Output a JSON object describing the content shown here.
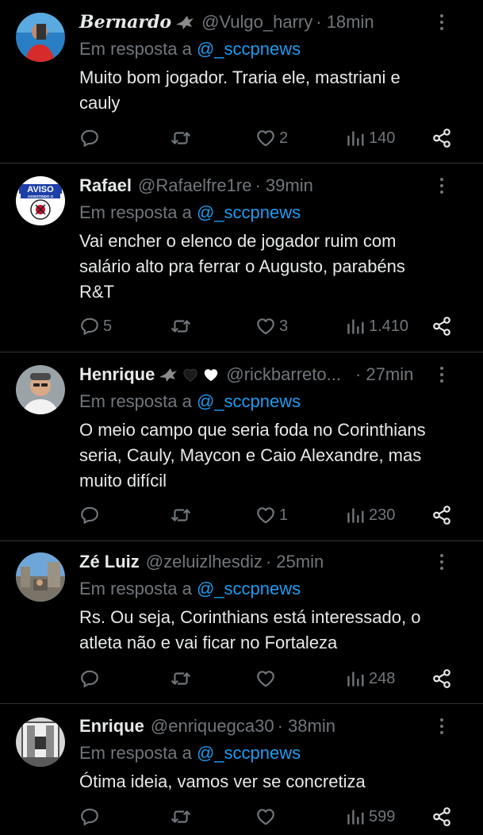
{
  "tweets": [
    {
      "name": "Bernardo",
      "handle": "@Vulgo_harry",
      "time": "· 18min",
      "reply_prefix": "Em resposta a ",
      "reply_to": "@_sccpnews",
      "text_lines": [
        "Muito bom jogador. Traria ele, mastriani e",
        "cauly"
      ],
      "replies": "",
      "retweets": "",
      "likes": "2",
      "views": "140"
    },
    {
      "name": "Rafael",
      "handle": "@Rafaelfre1re",
      "time": "· 39min",
      "reply_prefix": "Em resposta a ",
      "reply_to": "@_sccpnews",
      "text_lines": [
        "Vai encher o elenco de jogador ruim com",
        "salário alto pra ferrar o Augusto, parabéns",
        "R&T"
      ],
      "replies": "5",
      "retweets": "",
      "likes": "3",
      "views": "1.410",
      "avatar_text": "AVISO",
      "avatar_subtext": "ASSISTINDO O"
    },
    {
      "name": "Henrique",
      "handle": "@rickbarreto...",
      "time": "· 27min",
      "reply_prefix": "Em resposta a ",
      "reply_to": "@_sccpnews",
      "text_lines": [
        "O meio campo que seria foda no Corinthians",
        "seria, Cauly, Maycon e Caio Alexandre, mas",
        "muito difícil"
      ],
      "replies": "",
      "retweets": "",
      "likes": "1",
      "views": "230"
    },
    {
      "name": "Zé Luiz",
      "handle": "@zeluizlhesdiz",
      "time": "· 25min",
      "reply_prefix": "Em resposta a ",
      "reply_to": "@_sccpnews",
      "text_lines": [
        "Rs. Ou seja, Corinthians está interessado, o",
        "atleta não e vai ficar no Fortaleza"
      ],
      "replies": "",
      "retweets": "",
      "likes": "",
      "views": "248"
    },
    {
      "name": "Enrique",
      "handle": "@enriquegca30",
      "time": "· 38min",
      "reply_prefix": "Em resposta a ",
      "reply_to": "@_sccpnews",
      "text_lines": [
        "Ótima ideia, vamos ver se concretiza"
      ],
      "replies": "",
      "retweets": "",
      "likes": "",
      "views": "599"
    }
  ],
  "colors": {
    "background": "#000000",
    "text": "#e7e9ea",
    "muted": "#71767b",
    "mention": "#1d9bf0",
    "divider": "#2f3336"
  }
}
